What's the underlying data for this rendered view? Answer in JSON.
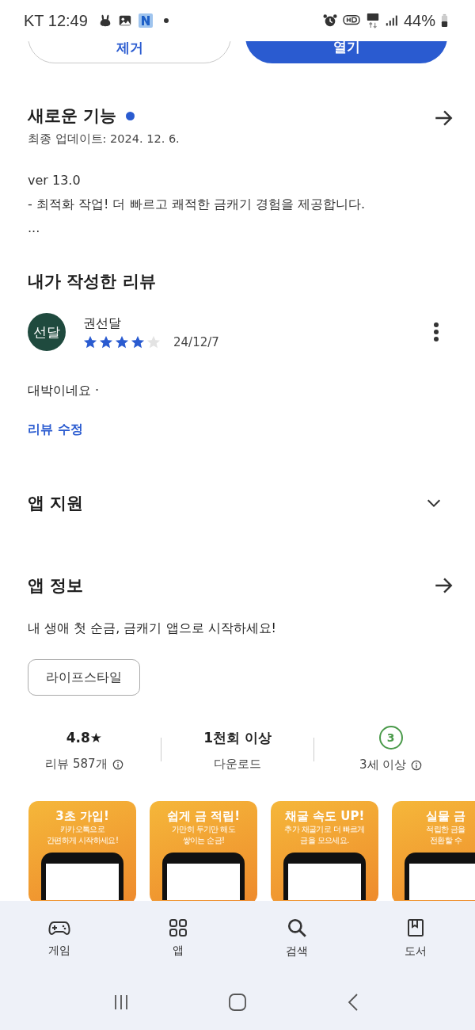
{
  "status_bar": {
    "carrier_time": "KT 12:49",
    "battery": "44%"
  },
  "action_buttons": [
    {
      "label": "제거",
      "kind": "outline"
    },
    {
      "label": "열기",
      "kind": "filled"
    }
  ],
  "whats_new": {
    "title": "새로운 기능",
    "unread": true,
    "updated": "최종 업데이트: 2024. 12. 6.",
    "lines": [
      "ver 13.0",
      "- 최적화 작업! 더 빠르고 쾌적한 금캐기 경험을 제공합니다.",
      "..."
    ]
  },
  "my_review": {
    "title": "내가 작성한 리뷰",
    "avatar": "선달",
    "author": "권선달",
    "stars": 4,
    "date": "24/12/7",
    "text": "대박이네요 ·",
    "edit_link": "리뷰 수정"
  },
  "app_support": {
    "title": "앱 지원",
    "expanded": false
  },
  "app_info": {
    "title": "앱 정보",
    "description": "내 생애 첫 순금, 금캐기 앱으로 시작하세요!",
    "tag": "라이프스타일"
  },
  "stats": [
    {
      "kind": "rating",
      "value": "4.8★",
      "label": "리뷰 587개"
    },
    {
      "kind": "text",
      "value": "1천회 이상",
      "label": "다운로드"
    },
    {
      "kind": "age",
      "value": "3",
      "label": "3세 이상"
    }
  ],
  "screenshots": [
    {
      "title": "3초 가입!",
      "lines": [
        "카카오톡으로",
        "간편하게 시작하세요!"
      ]
    },
    {
      "title": "쉽게 금 적립!",
      "lines": [
        "가만히 두기만 해도",
        "쌓이는 순금!"
      ]
    },
    {
      "title": "채굴 속도 UP!",
      "lines": [
        "추가 채굴기로 더 빠르게",
        "금을 모으세요."
      ]
    },
    {
      "title": "실물 금",
      "lines": [
        "적립한 금을",
        "전환할 수"
      ]
    }
  ],
  "bottom_nav": [
    {
      "label": "게임",
      "kind": "games",
      "selected": false
    },
    {
      "label": "앱",
      "kind": "apps",
      "selected": false
    },
    {
      "label": "검색",
      "kind": "search",
      "selected": false
    },
    {
      "label": "도서",
      "kind": "books",
      "selected": false
    }
  ]
}
